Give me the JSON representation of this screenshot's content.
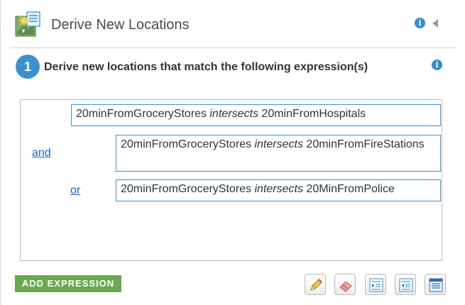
{
  "header": {
    "title": "Derive New Locations",
    "info_icon": "info-icon",
    "collapse_icon": "collapse-left-icon",
    "app_icon": "derive-locations-icon"
  },
  "step": {
    "number": "1",
    "text": "Derive new locations that match the following expression(s)",
    "info_icon": "info-icon"
  },
  "expressions": [
    {
      "operator": "",
      "layer1": "20minFromGroceryStores",
      "relation": "intersects",
      "layer2": "20minFromHospitals"
    },
    {
      "operator": "and",
      "layer1": "20minFromGroceryStores",
      "relation": "intersects",
      "layer2": "20minFromFireStations"
    },
    {
      "operator": "or",
      "layer1": "20minFromGroceryStores",
      "relation": "intersects",
      "layer2": "20MinFromPolice"
    }
  ],
  "toolbar": {
    "add_expression_label": "ADD EXPRESSION",
    "buttons": [
      "edit-pencil-icon",
      "eraser-icon",
      "indent-icon",
      "outdent-icon",
      "list-icon"
    ]
  },
  "colors": {
    "accent_blue": "#3a93cf",
    "add_button_green": "#6aa84f",
    "link_blue": "#1a5fbf"
  }
}
